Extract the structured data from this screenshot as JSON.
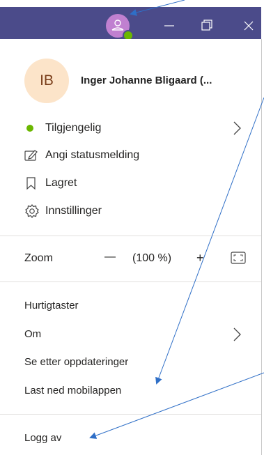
{
  "window": {
    "avatar_icon": "person-icon",
    "presence_color": "#6bb700",
    "titlebar_color": "#4b4b8a",
    "minimize_icon": "minimize-icon",
    "restore_icon": "restore-icon",
    "close_icon": "close-icon"
  },
  "profile": {
    "initials": "IB",
    "name": "Inger Johanne Bligaard (..."
  },
  "status": {
    "label": "Tilgjengelig",
    "color": "#6bb700"
  },
  "items_top": [
    {
      "label": "Angi statusmelding",
      "icon": "edit-status-icon"
    },
    {
      "label": "Lagret",
      "icon": "bookmark-icon"
    },
    {
      "label": "Innstillinger",
      "icon": "gear-icon"
    }
  ],
  "zoom": {
    "label": "Zoom",
    "minus": "—",
    "value": "(100 %)",
    "plus": "+",
    "fullscreen_icon": "fullscreen-icon"
  },
  "items_bottom": [
    {
      "label": "Hurtigtaster"
    },
    {
      "label": "Om"
    },
    {
      "label": "Se etter oppdateringer"
    },
    {
      "label": "Last ned mobilappen"
    }
  ],
  "logout": {
    "label": "Logg av"
  },
  "annotation_color": "#2f6fc7"
}
